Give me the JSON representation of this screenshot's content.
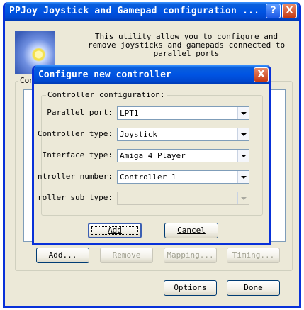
{
  "main_window": {
    "title": "PPJoy Joystick and Gamepad configuration ...",
    "help_glyph": "?",
    "close_glyph": "X",
    "description": "This utility allow you to configure and remove joysticks and gamepads connected to parallel ports",
    "group_label_partial": "Con",
    "buttons": {
      "add": "Add...",
      "remove": "Remove",
      "mapping": "Mapping...",
      "timing": "Timing...",
      "options": "Options",
      "done": "Done"
    },
    "banner_icon": "morning-glory-flower-image"
  },
  "dialog": {
    "title": "Configure new controller",
    "close_glyph": "X",
    "group_label": "Controller configuration:",
    "fields": [
      {
        "label": "Parallel port:",
        "value": "LPT1",
        "enabled": true
      },
      {
        "label": "Controller type:",
        "value": "Joystick",
        "enabled": true
      },
      {
        "label": "Interface type:",
        "value": "Amiga 4 Player",
        "enabled": true
      },
      {
        "label": "Controller number:",
        "value": "Controller 1",
        "enabled": true
      },
      {
        "label": "Controller sub type:",
        "value": "",
        "enabled": false
      }
    ],
    "buttons": {
      "add": "Add",
      "cancel": "Cancel"
    }
  },
  "colors": {
    "titlebar": "#0054e3",
    "window_face": "#ece9d8",
    "close_button": "#c53a14",
    "disabled_text": "#a0a090"
  }
}
